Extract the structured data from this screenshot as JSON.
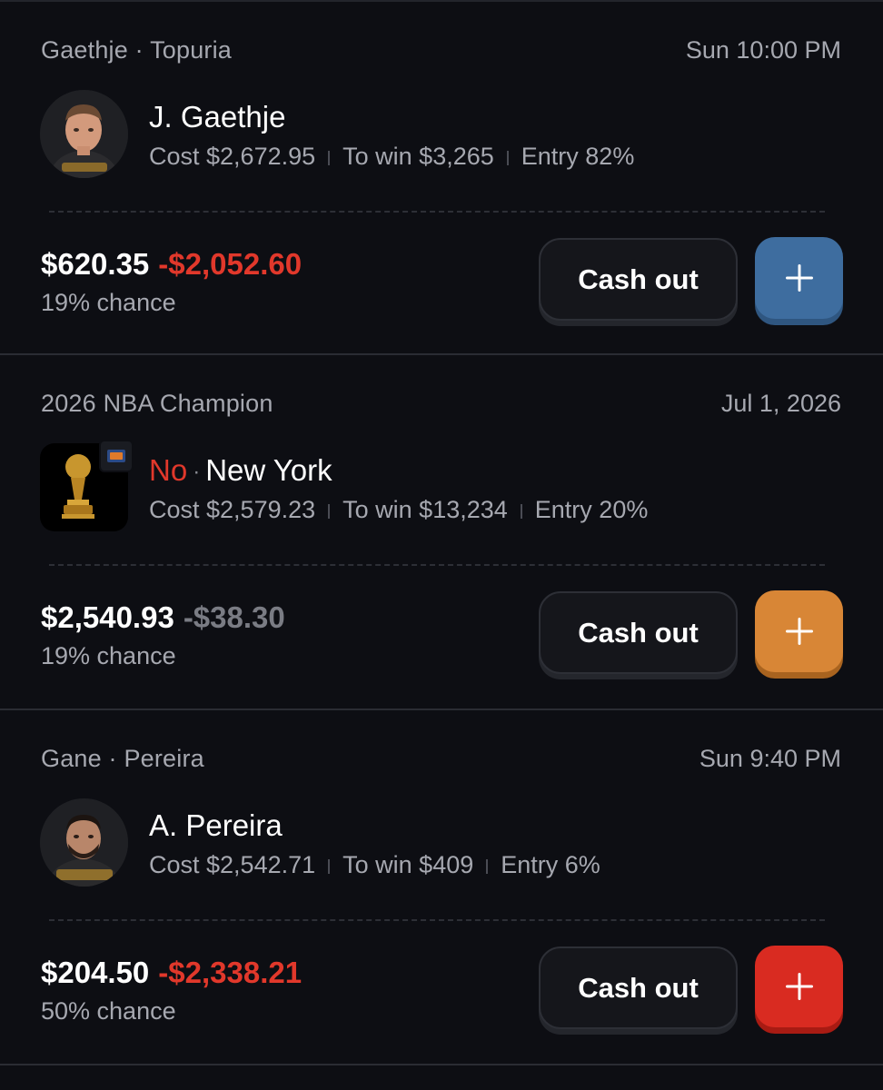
{
  "positions": [
    {
      "event": "Gaethje · Topuria",
      "time": "Sun 10:00 PM",
      "title": "J. Gaethje",
      "cost": "Cost $2,672.95",
      "to_win": "To win $3,265",
      "entry": "Entry 82%",
      "current_value": "$620.35",
      "change": "-$2,052.60",
      "chance": "19% chance",
      "cash_out_label": "Cash out",
      "plus_label": "+",
      "accent_color": "#3e6d9f",
      "accent_shadow": "#2f5680",
      "avatar_icon": "fighter-avatar"
    },
    {
      "event": "2026 NBA Champion",
      "time": "Jul 1, 2026",
      "side": "No",
      "title": "New York",
      "cost": "Cost $2,579.23",
      "to_win": "To win $13,234",
      "entry": "Entry 20%",
      "current_value": "$2,540.93",
      "change": "-$38.30",
      "chance": "19% chance",
      "cash_out_label": "Cash out",
      "plus_label": "+",
      "accent_color": "#d88636",
      "accent_shadow": "#a8631f",
      "avatar_icon": "trophy-icon"
    },
    {
      "event": "Gane · Pereira",
      "time": "Sun 9:40 PM",
      "title": "A. Pereira",
      "cost": "Cost $2,542.71",
      "to_win": "To win $409",
      "entry": "Entry 6%",
      "current_value": "$204.50",
      "change": "-$2,338.21",
      "chance": "50% chance",
      "cash_out_label": "Cash out",
      "plus_label": "+",
      "accent_color": "#d92b21",
      "accent_shadow": "#a81b13",
      "avatar_icon": "fighter-avatar"
    }
  ],
  "colors": {
    "background": "#0d0e13",
    "negative": "#e1382b",
    "muted_negative": "#7a7c84",
    "secondary_text": "#a6a8b0"
  }
}
